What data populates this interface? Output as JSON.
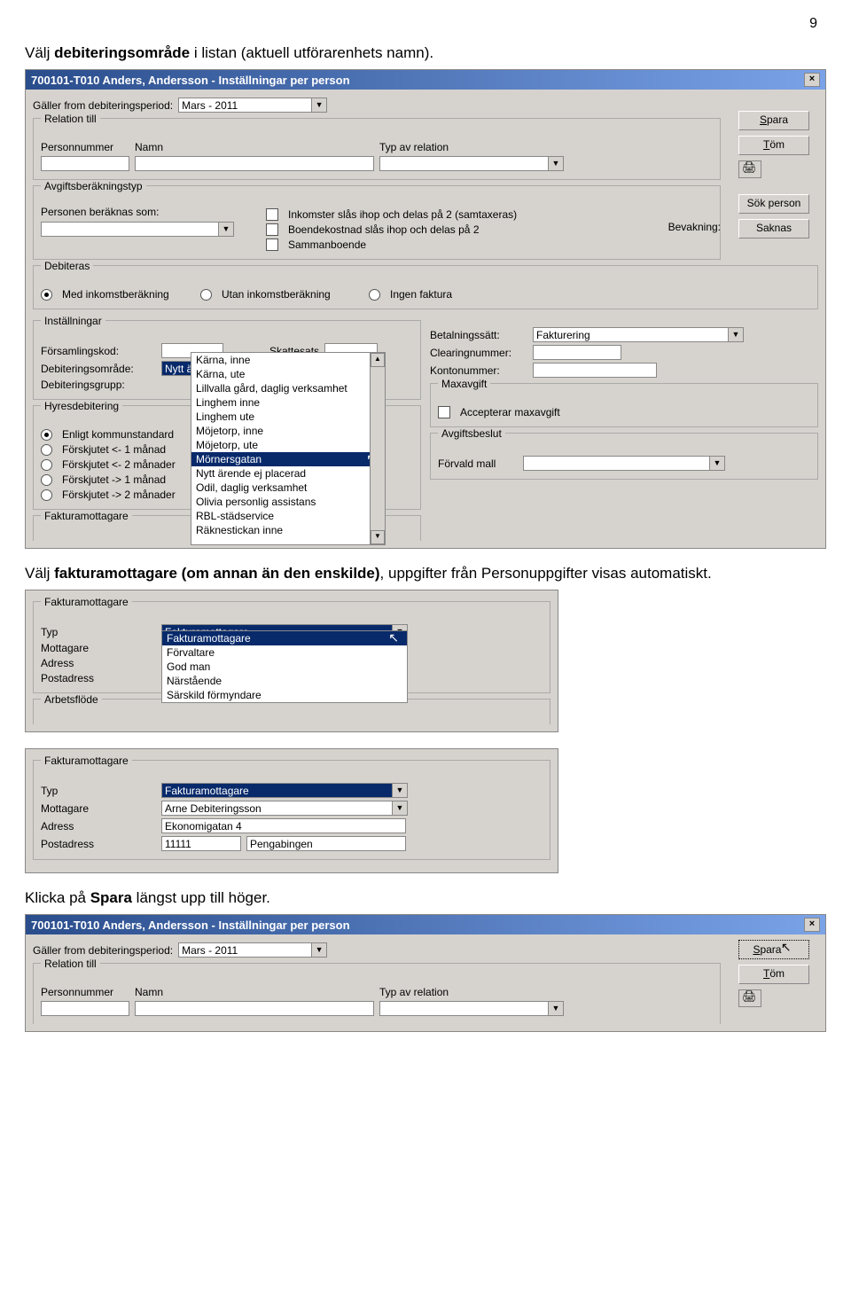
{
  "pagenum": "9",
  "p1_pre": "Välj  ",
  "p1_b": "debiteringsområde",
  "p1_post": " i listan (aktuell utförarenhets namn).",
  "p2_pre": "Välj ",
  "p2_b": "fakturamottagare (om annan än den enskilde)",
  "p2_post": ", uppgifter från Personuppgifter visas automatiskt.",
  "p3_pre": "Klicka på ",
  "p3_b": "Spara",
  "p3_post": " längst upp till höger.",
  "dlg": {
    "title": "700101-T010 Anders, Andersson - Inställningar per person",
    "gallerLbl": "Gäller from debiteringsperiod:",
    "gallerVal": "Mars - 2011",
    "btnSpara": "Spara",
    "btnTom": "Töm",
    "btnSok": "Sök person",
    "btnSaknas": "Saknas",
    "bevakning": "Bevakning:",
    "g_relation": "Relation till",
    "personnummer": "Personnummer",
    "namn": "Namn",
    "typrel": "Typ av relation",
    "g_avg": "Avgiftsberäkningstyp",
    "personBer": "Personen beräknas som:",
    "chk1": "Inkomster slås ihop och delas på 2 (samtaxeras)",
    "chk2": "Boendekostnad slås ihop och delas på 2",
    "chk3": "Sammanboende",
    "g_deb": "Debiteras",
    "r1": "Med inkomstberäkning",
    "r2": "Utan inkomstberäkning",
    "r3": "Ingen faktura",
    "g_inst": "Inställningar",
    "forsamling": "Församlingskod:",
    "skattesats": "Skattesats",
    "debomr": "Debiteringsområde:",
    "debgrupp": "Debiteringsgrupp:",
    "debomrVal": "Nytt ärende ej placerad",
    "list": [
      "Kärna, inne",
      "Kärna, ute",
      "Lillvalla gård, daglig verksamhet",
      "Linghem inne",
      "Linghem ute",
      "Möjetorp, inne",
      "Möjetorp, ute",
      "Mörnersgatan",
      "Nytt ärende ej placerad",
      "Odil, daglig verksamhet",
      "Olivia personlig assistans",
      "RBL-städservice",
      "Räknestickan inne"
    ],
    "betal": "Betalningssätt:",
    "betalVal": "Fakturering",
    "clearing": "Clearingnummer:",
    "konto": "Kontonummer:",
    "g_max": "Maxavgift",
    "accmax": "Accepterar maxavgift",
    "g_avgb": "Avgiftsbeslut",
    "forvald": "Förvald mall",
    "g_hyres": "Hyresdebitering",
    "h1": "Enligt kommunstandard",
    "h2": "Förskjutet <- 1 månad",
    "h3": "Förskjutet <- 2 månader",
    "h4": "Förskjutet -> 1 månad",
    "h5": "Förskjutet -> 2 månader",
    "g_fakt": "Fakturamottagare"
  },
  "fm": {
    "g": "Fakturamottagare",
    "typ": "Typ",
    "mottagare": "Mottagare",
    "adress": "Adress",
    "postadress": "Postadress",
    "typVal": "Fakturamottagare",
    "list": [
      "Fakturamottagare",
      "Förvaltare",
      "God man",
      "Närstående",
      "Särskild förmyndare"
    ],
    "arbets": "Arbetsflöde"
  },
  "fm2": {
    "mottagareVal": "Arne Debiteringsson",
    "adressVal": "Ekonomigatan 4",
    "postnr": "11111",
    "ort": "Pengabingen"
  }
}
